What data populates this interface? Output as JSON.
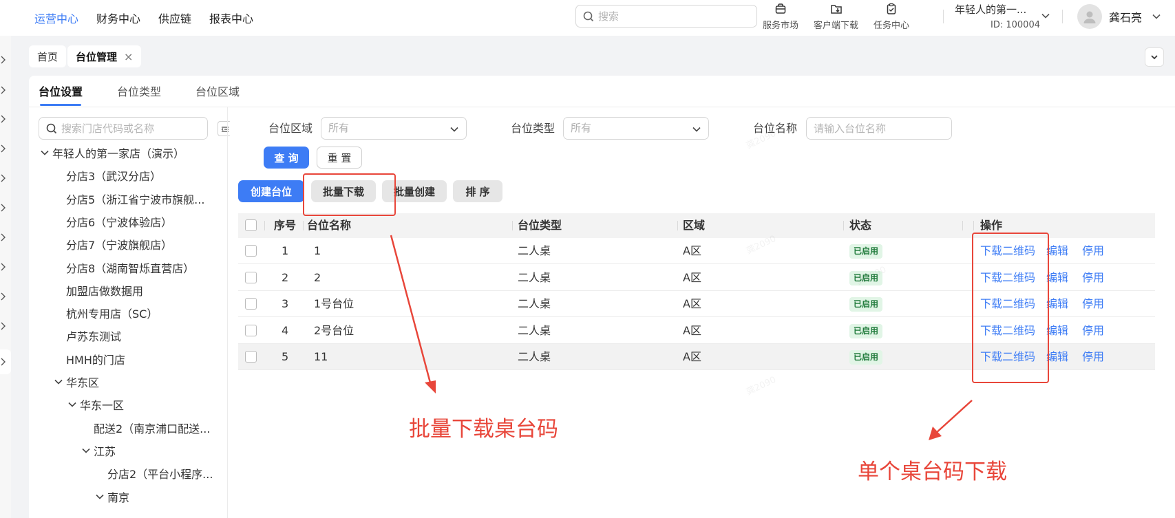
{
  "topnav": {
    "items": [
      "运营中心",
      "财务中心",
      "供应链",
      "报表中心"
    ],
    "active_index": 0
  },
  "search": {
    "placeholder": "搜索"
  },
  "tools": [
    {
      "label": "服务市场",
      "icon": "shop-bag-icon"
    },
    {
      "label": "客户端下载",
      "icon": "folder-download-icon"
    },
    {
      "label": "任务中心",
      "icon": "clipboard-check-icon"
    }
  ],
  "tenant": {
    "name": "年轻人的第一...",
    "id": "ID: 100004"
  },
  "user": {
    "name": "龚石亮"
  },
  "tabs": [
    {
      "label": "首页",
      "active": false
    },
    {
      "label": "台位管理",
      "active": true,
      "close": "×"
    }
  ],
  "subtabs": [
    "台位设置",
    "台位类型",
    "台位区域"
  ],
  "tree": {
    "search_placeholder": "搜索门店代码或名称",
    "nodes": [
      {
        "label": "年轻人的第一家店（演示）",
        "level": 0,
        "expanded": true
      },
      {
        "label": "分店3（武汉分店）",
        "level": 1
      },
      {
        "label": "分店5（浙江省宁波市旗舰...",
        "level": 1
      },
      {
        "label": "分店6（宁波体验店）",
        "level": 1
      },
      {
        "label": "分店7（宁波旗舰店）",
        "level": 1
      },
      {
        "label": "分店8（湖南智烁直营店）",
        "level": 1
      },
      {
        "label": "加盟店做数据用",
        "level": 1
      },
      {
        "label": "杭州专用店（SC）",
        "level": 1
      },
      {
        "label": "卢苏东测试",
        "level": 1
      },
      {
        "label": "HMH的门店",
        "level": 1
      },
      {
        "label": "华东区",
        "level": 1,
        "expanded": true
      },
      {
        "label": "华东一区",
        "level": 2,
        "expanded": true
      },
      {
        "label": "配送2（南京浦口配送...",
        "level": 3
      },
      {
        "label": "江苏",
        "level": 3,
        "expanded": true
      },
      {
        "label": "分店2（平台小程序...",
        "level": 4
      },
      {
        "label": "南京",
        "level": 4,
        "expanded": true
      }
    ]
  },
  "filters": {
    "area_label": "台位区域",
    "area_value": "所有",
    "type_label": "台位类型",
    "type_value": "所有",
    "name_label": "台位名称",
    "name_placeholder": "请输入台位名称",
    "query_button": "查 询",
    "reset_button": "重 置"
  },
  "actions": {
    "create": "创建台位",
    "batch_download": "批量下载",
    "batch_create": "批量创建",
    "sort": "排 序"
  },
  "table": {
    "headers": [
      "序号",
      "台位名称",
      "台位类型",
      "区域",
      "状态",
      "操作"
    ],
    "rows": [
      {
        "no": "1",
        "name": "1",
        "type": "二人桌",
        "area": "A区",
        "status": "已启用"
      },
      {
        "no": "2",
        "name": "2",
        "type": "二人桌",
        "area": "A区",
        "status": "已启用"
      },
      {
        "no": "3",
        "name": "1号台位",
        "type": "二人桌",
        "area": "A区",
        "status": "已启用"
      },
      {
        "no": "4",
        "name": "2号台位",
        "type": "二人桌",
        "area": "A区",
        "status": "已启用"
      },
      {
        "no": "5",
        "name": "11",
        "type": "二人桌",
        "area": "A区",
        "status": "已启用"
      }
    ],
    "ops": [
      "下载二维码",
      "编辑",
      "停用"
    ]
  },
  "annotations": {
    "batch_text": "批量下载桌台码",
    "single_text": "单个桌台码下载",
    "color": "#e8463a"
  },
  "colors": {
    "primary": "#3d7cf5",
    "status_bg": "#e1f5e6",
    "status_text": "#1f7a3a"
  }
}
